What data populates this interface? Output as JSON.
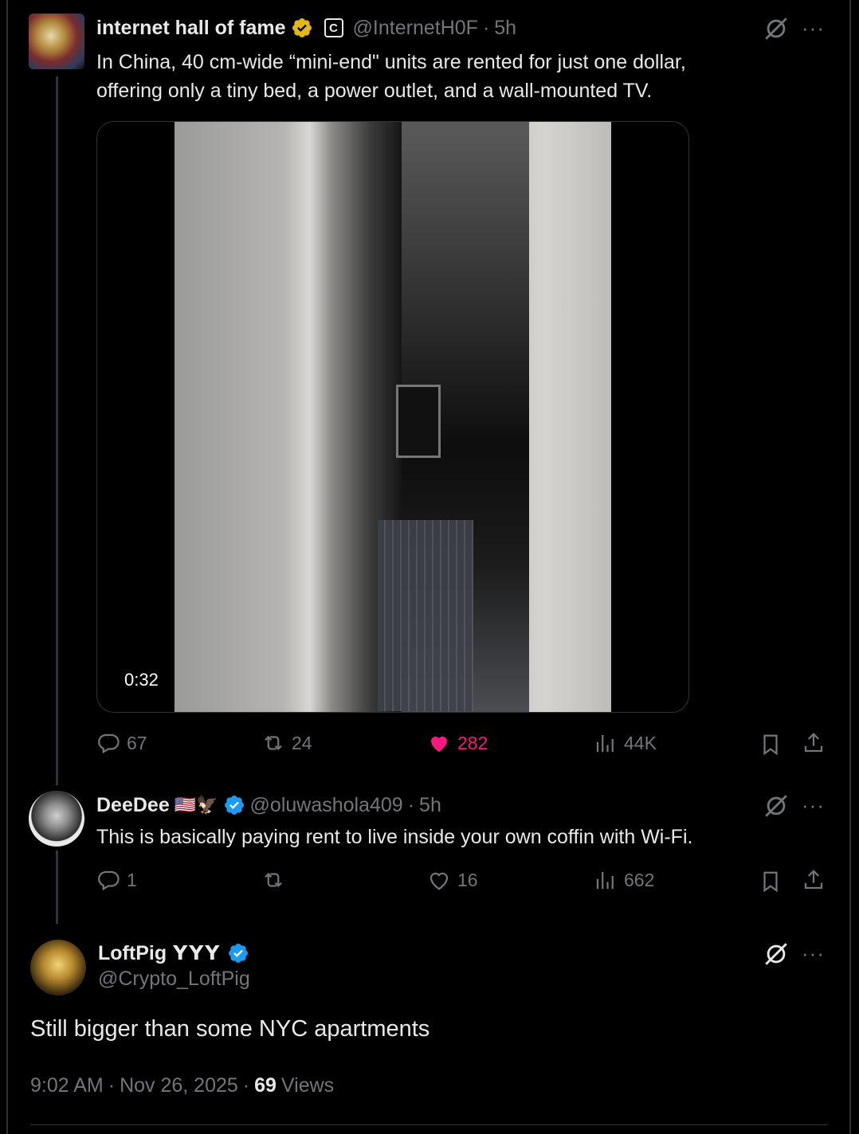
{
  "tweet1": {
    "name": "internet hall of fame",
    "affiliate_badge": "C",
    "handle": "@InternetH0F",
    "time": "5h",
    "text_line1": "In China, 40 cm-wide “mini-end\" units are rented for just one dollar,",
    "text_line2": "offering only a tiny bed, a power outlet, and a wall-mounted TV.",
    "video_duration": "0:32",
    "replies": "67",
    "reposts": "24",
    "likes": "282",
    "views": "44K"
  },
  "tweet2": {
    "name": "DeeDee",
    "name_emoji": "🇺🇸🦅",
    "handle": "@oluwashola409",
    "time": "5h",
    "text": "This is basically paying rent to live inside your own coffin with Wi-Fi.",
    "replies": "1",
    "reposts": "",
    "likes": "16",
    "views": "662"
  },
  "tweet3": {
    "name": "LoftPig",
    "name_suffix": "ꓬꓬꓬ",
    "handle": "@Crypto_LoftPig",
    "text": "Still bigger than some NYC apartments",
    "time": "9:02 AM",
    "date": "Nov 26, 2025",
    "views_count": "69",
    "views_label": "Views"
  },
  "separator": "·",
  "more_label": "···",
  "icons": {
    "reply": "reply-icon",
    "repost": "repost-icon",
    "like": "heart-icon",
    "views": "views-icon",
    "bookmark": "bookmark-icon",
    "share": "share-icon",
    "grok": "grok-icon",
    "verified": "verified-badge-icon"
  },
  "colors": {
    "like": "#f91880",
    "verified_blue": "#1d9bf0",
    "verified_gold": "#e2b719",
    "muted": "#71767b",
    "text": "#e7e9ea"
  }
}
